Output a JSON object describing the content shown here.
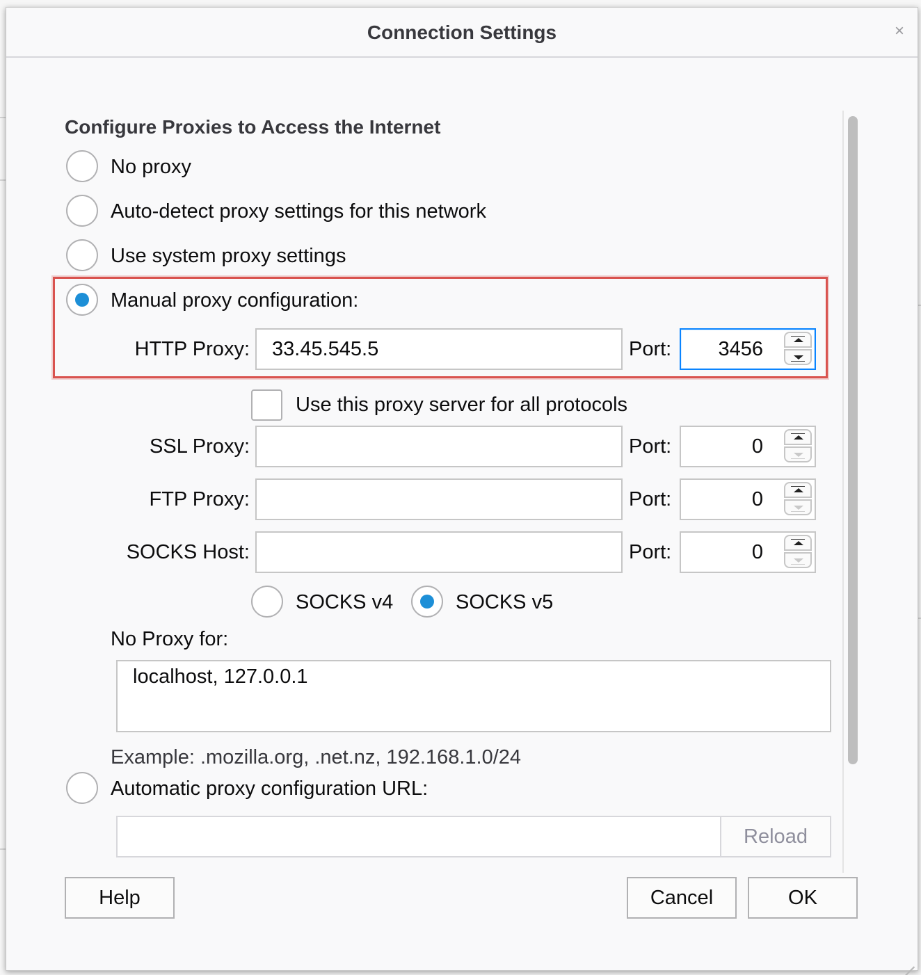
{
  "dialog": {
    "title": "Connection Settings",
    "close_symbol": "×"
  },
  "section": {
    "heading": "Configure Proxies to Access the Internet"
  },
  "proxy_modes": {
    "no_proxy": "No proxy",
    "auto_detect": "Auto-detect proxy settings for this network",
    "system": "Use system proxy settings",
    "manual": "Manual proxy configuration:",
    "auto_url": "Automatic proxy configuration URL:",
    "selected": "manual"
  },
  "manual": {
    "http_label": "HTTP Proxy:",
    "http_value": "33.45.545.5",
    "http_port_label": "Port:",
    "http_port": "3456",
    "all_protocols_label": "Use this proxy server for all protocols",
    "all_protocols_checked": false,
    "ssl_label": "SSL Proxy:",
    "ssl_value": "",
    "ssl_port_label": "Port:",
    "ssl_port": "0",
    "ftp_label": "FTP Proxy:",
    "ftp_value": "",
    "ftp_port_label": "Port:",
    "ftp_port": "0",
    "socks_label": "SOCKS Host:",
    "socks_value": "",
    "socks_port_label": "Port:",
    "socks_port": "0",
    "socks_v4": "SOCKS v4",
    "socks_v5": "SOCKS v5",
    "socks_selected": "v5"
  },
  "no_proxy": {
    "label": "No Proxy for:",
    "value": "localhost, 127.0.0.1",
    "example": "Example: .mozilla.org, .net.nz, 192.168.1.0/24"
  },
  "auto_url": {
    "value": "",
    "reload_label": "Reload"
  },
  "buttons": {
    "help": "Help",
    "cancel": "Cancel",
    "ok": "OK"
  },
  "colors": {
    "accent": "#1d8fd7",
    "highlight_border": "#d9534f",
    "focus_border": "#0a84ff"
  }
}
